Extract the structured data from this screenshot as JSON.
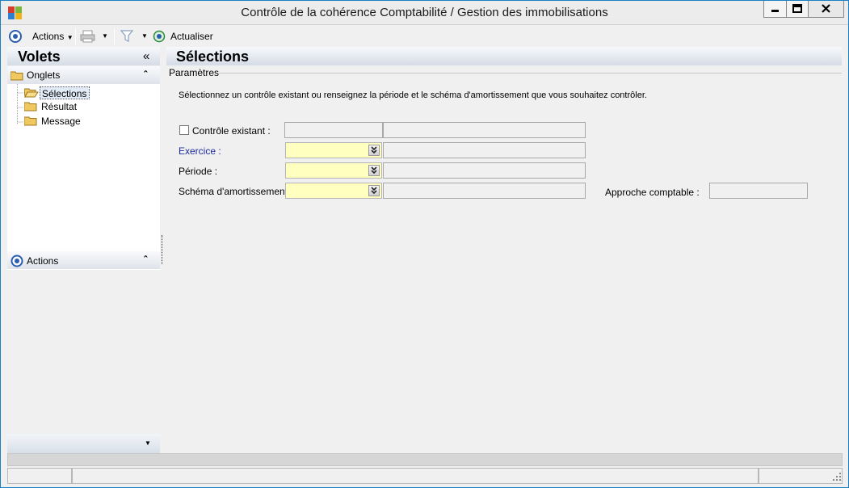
{
  "window": {
    "title": "Contrôle de la cohérence Comptabilité / Gestion des immobilisations",
    "controls": {
      "minimize": "minimize-icon",
      "maximize": "maximize-icon",
      "close": "close-icon"
    }
  },
  "toolbar": {
    "actions_label": "Actions",
    "refresh_label": "Actualiser",
    "icons": [
      "actions-icon",
      "printer-icon",
      "filter-icon",
      "refresh-icon"
    ]
  },
  "left_panel": {
    "title": "Volets",
    "tabs_section": {
      "label": "Onglets",
      "items": [
        {
          "label": "Sélections",
          "selected": true
        },
        {
          "label": "Résultat",
          "selected": false
        },
        {
          "label": "Message",
          "selected": false
        }
      ]
    },
    "actions_section": {
      "label": "Actions"
    }
  },
  "main": {
    "title": "Sélections",
    "group_label": "Paramètres",
    "instruction": "Sélectionnez un contrôle existant ou renseignez la période et le schéma d'amortissement que vous souhaitez contrôler.",
    "fields": {
      "existing_control_label": "Contrôle existant :",
      "existing_control_checked": false,
      "fiscal_year_label": "Exercice :",
      "period_label": "Période :",
      "depreciation_schema_label": "Schéma d'amortissement :",
      "accounting_approach_label": "Approche comptable :"
    }
  },
  "colors": {
    "window_border": "#1b7fc4",
    "link_label": "#1c2c9c",
    "combo_background": "#ffffc0",
    "header_gradient_end": "#d5dce6"
  }
}
